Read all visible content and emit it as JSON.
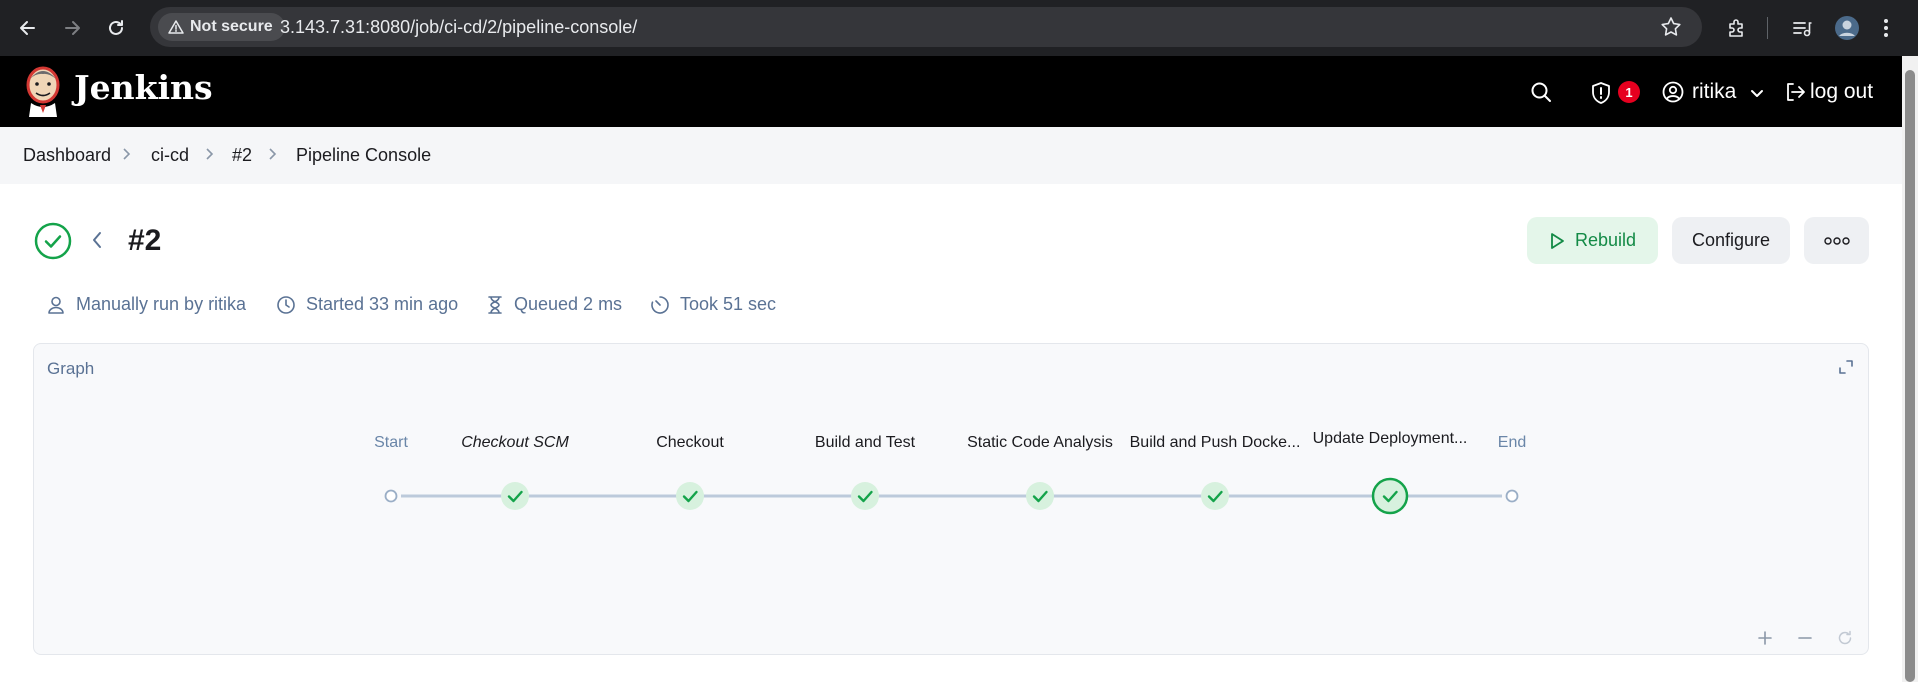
{
  "browser": {
    "security_label": "Not secure",
    "url": "3.143.7.31:8080/job/ci-cd/2/pipeline-console/"
  },
  "header": {
    "app_title": "Jenkins",
    "notification_count": "1",
    "user_name": "ritika",
    "logout_label": "log out"
  },
  "breadcrumb": {
    "items": [
      "Dashboard",
      "ci-cd",
      "#2",
      "Pipeline Console"
    ]
  },
  "build": {
    "number": "#2",
    "status_color": "#14a34a",
    "actions": {
      "rebuild": "Rebuild",
      "configure": "Configure"
    },
    "meta": {
      "run_by": "Manually run by ritika",
      "started": "Started 33 min ago",
      "queued": "Queued 2 ms",
      "took": "Took 51 sec"
    }
  },
  "graph": {
    "title": "Graph",
    "nodes": [
      {
        "label": "Start",
        "kind": "terminal"
      },
      {
        "label": "Checkout SCM",
        "kind": "stage",
        "italic": true
      },
      {
        "label": "Checkout",
        "kind": "stage"
      },
      {
        "label": "Build and Test",
        "kind": "stage"
      },
      {
        "label": "Static Code Analysis",
        "kind": "stage"
      },
      {
        "label": "Build and Push Docke...",
        "kind": "stage"
      },
      {
        "label": "Update Deployment...",
        "kind": "stage",
        "selected": true
      },
      {
        "label": "End",
        "kind": "terminal"
      }
    ]
  }
}
